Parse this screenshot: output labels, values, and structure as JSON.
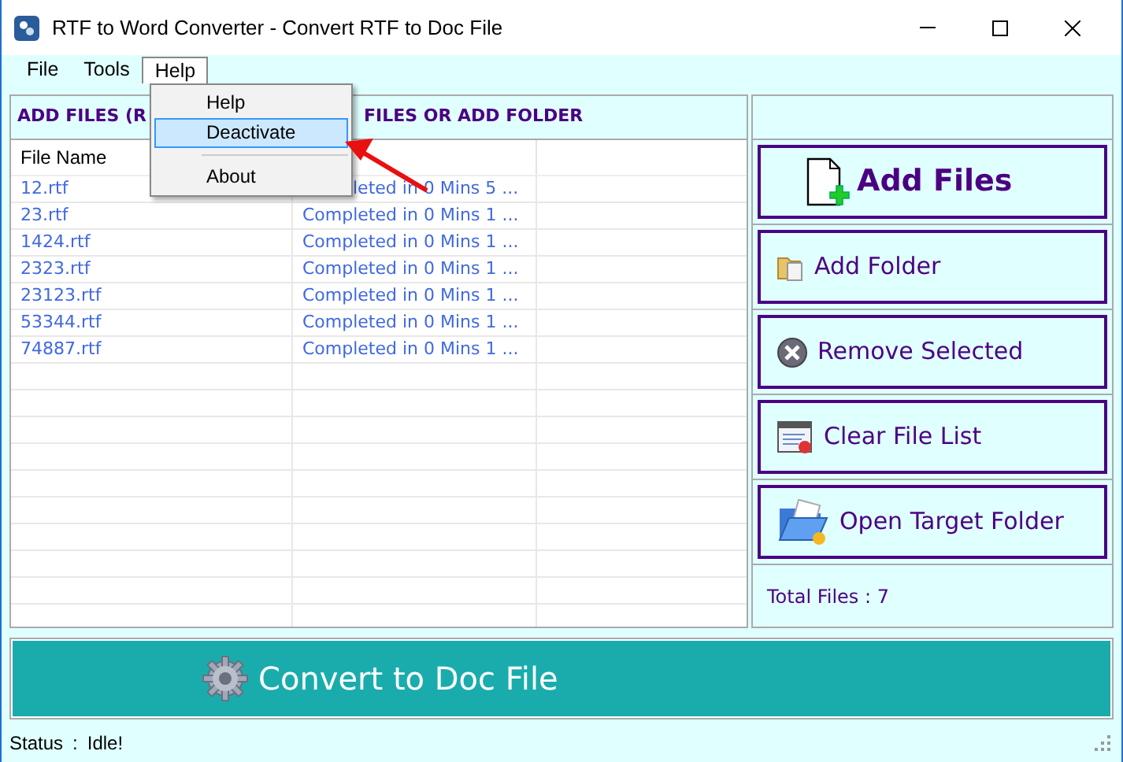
{
  "window": {
    "title": "RTF to Word Converter -  Convert RTF to Doc File"
  },
  "menu_bar": [
    {
      "label": "File",
      "selected": false
    },
    {
      "label": "Tools",
      "selected": false
    },
    {
      "label": "Help",
      "selected": true
    }
  ],
  "help_menu": {
    "items": [
      {
        "kind": "item",
        "label": "Help",
        "selected": false
      },
      {
        "kind": "item",
        "label": "Deactivate",
        "selected": true
      },
      {
        "kind": "separator"
      },
      {
        "kind": "item",
        "label": "About",
        "selected": false
      }
    ]
  },
  "panel_header": {
    "left": "ADD FILES (R",
    "right": "FILES OR ADD FOLDER"
  },
  "table": {
    "columns": [
      "File Name"
    ],
    "rows": [
      {
        "file": "12.rtf",
        "status": "leted in 0 Mins 5 ...",
        "status_partly_hidden": true
      },
      {
        "file": "23.rtf",
        "status": "Completed in 0 Mins 1 ...",
        "status_partly_hidden": false
      },
      {
        "file": "1424.rtf",
        "status": "Completed in 0 Mins 1 ...",
        "status_partly_hidden": false
      },
      {
        "file": "2323.rtf",
        "status": "Completed in 0 Mins 1 ...",
        "status_partly_hidden": false
      },
      {
        "file": "23123.rtf",
        "status": "Completed in 0 Mins 1 ...",
        "status_partly_hidden": false
      },
      {
        "file": "53344.rtf",
        "status": "Completed in 0 Mins 1 ...",
        "status_partly_hidden": false
      },
      {
        "file": "74887.rtf",
        "status": "Completed in 0 Mins 1 ...",
        "status_partly_hidden": false
      }
    ]
  },
  "actions": [
    {
      "kind": "add_files",
      "label": "Add Files"
    },
    {
      "kind": "add_folder",
      "label": "Add Folder"
    },
    {
      "kind": "remove",
      "label": "Remove Selected"
    },
    {
      "kind": "clear",
      "label": "Clear File List"
    },
    {
      "kind": "open_target",
      "label": "Open Target Folder"
    }
  ],
  "total_files": "Total Files : 7",
  "convert_button": "Convert to Doc File",
  "status_bar": {
    "label": "Status",
    "separator": ":",
    "value": "Idle!"
  }
}
